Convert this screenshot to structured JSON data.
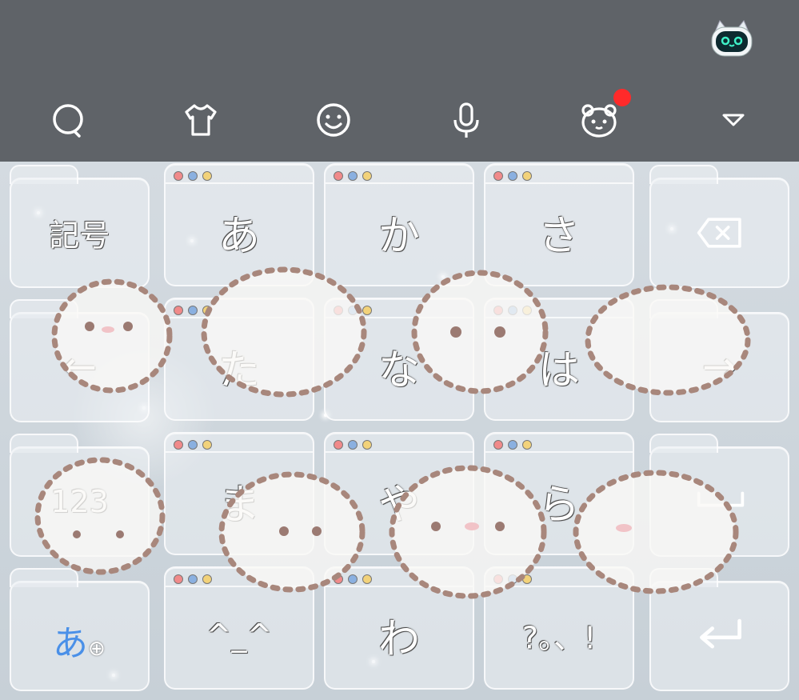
{
  "toolbar": {
    "items": [
      {
        "name": "search",
        "icon": "search-icon"
      },
      {
        "name": "theme",
        "icon": "shirt-icon"
      },
      {
        "name": "emoji",
        "icon": "smiley-icon"
      },
      {
        "name": "voice",
        "icon": "microphone-icon"
      },
      {
        "name": "mascot",
        "icon": "bear-face-icon",
        "badge": "red-dot"
      },
      {
        "name": "collapse",
        "icon": "triangle-down-icon"
      }
    ],
    "notification_color": "#ff2a2a"
  },
  "keyboard": {
    "row1": {
      "left": "記号",
      "k1": "あ",
      "k2": "か",
      "k3": "さ",
      "right": "⌫"
    },
    "row2": {
      "left": "←",
      "k1": "た",
      "k2": "な",
      "k3": "は",
      "right": "→"
    },
    "row3": {
      "left": "123",
      "k1": "ま",
      "k2": "や",
      "k3": "ら",
      "right": "␣"
    },
    "row4": {
      "left": "あ",
      "left_globe": "⊕",
      "k1": "^_^",
      "k2": "わ",
      "k3": "?。、!",
      "right": "↵"
    }
  },
  "colors": {
    "toolbar_bg": "#5f6368",
    "accent": "#4a90e8"
  }
}
